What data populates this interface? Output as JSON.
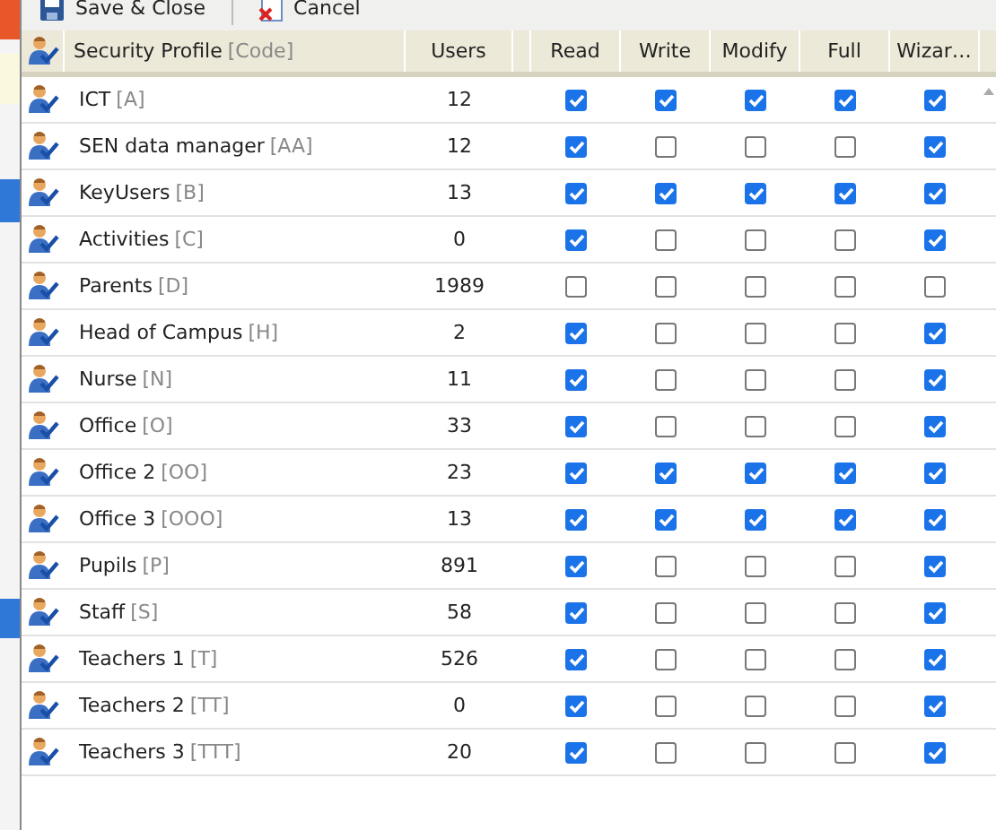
{
  "toolbar": {
    "buttons": [
      {
        "label": "Save & Close",
        "kind": "save"
      },
      {
        "label": "Cancel",
        "kind": "cancel"
      }
    ]
  },
  "table": {
    "columns": [
      {
        "label": "Security Profile",
        "code": "[Code]",
        "kind": "profile"
      },
      {
        "label": "Users",
        "kind": "count"
      },
      {
        "label": "Read",
        "kind": "check"
      },
      {
        "label": "Write",
        "kind": "check"
      },
      {
        "label": "Modify",
        "kind": "check"
      },
      {
        "label": "Full",
        "kind": "check"
      },
      {
        "label": "Wizar…",
        "kind": "check"
      }
    ],
    "rows": [
      {
        "name": "ICT",
        "code": "[A]",
        "users": "12",
        "read": true,
        "write": true,
        "modify": true,
        "full": true,
        "wizard": true
      },
      {
        "name": "SEN data manager",
        "code": "[AA]",
        "users": "12",
        "read": true,
        "write": false,
        "modify": false,
        "full": false,
        "wizard": true
      },
      {
        "name": "KeyUsers",
        "code": "[B]",
        "users": "13",
        "read": true,
        "write": true,
        "modify": true,
        "full": true,
        "wizard": true
      },
      {
        "name": "Activities",
        "code": "[C]",
        "users": "0",
        "read": true,
        "write": false,
        "modify": false,
        "full": false,
        "wizard": true
      },
      {
        "name": "Parents",
        "code": "[D]",
        "users": "1989",
        "read": false,
        "write": false,
        "modify": false,
        "full": false,
        "wizard": false
      },
      {
        "name": "Head of Campus",
        "code": "[H]",
        "users": "2",
        "read": true,
        "write": false,
        "modify": false,
        "full": false,
        "wizard": true
      },
      {
        "name": "Nurse",
        "code": "[N]",
        "users": "11",
        "read": true,
        "write": false,
        "modify": false,
        "full": false,
        "wizard": true
      },
      {
        "name": "Office",
        "code": "[O]",
        "users": "33",
        "read": true,
        "write": false,
        "modify": false,
        "full": false,
        "wizard": true
      },
      {
        "name": "Office 2",
        "code": "[OO]",
        "users": "23",
        "read": true,
        "write": true,
        "modify": true,
        "full": true,
        "wizard": true
      },
      {
        "name": "Office 3",
        "code": "[OOO]",
        "users": "13",
        "read": true,
        "write": true,
        "modify": true,
        "full": true,
        "wizard": true
      },
      {
        "name": "Pupils",
        "code": "[P]",
        "users": "891",
        "read": true,
        "write": false,
        "modify": false,
        "full": false,
        "wizard": true
      },
      {
        "name": "Staff",
        "code": "[S]",
        "users": "58",
        "read": true,
        "write": false,
        "modify": false,
        "full": false,
        "wizard": true
      },
      {
        "name": "Teachers 1",
        "code": "[T]",
        "users": "526",
        "read": true,
        "write": false,
        "modify": false,
        "full": false,
        "wizard": true
      },
      {
        "name": "Teachers 2",
        "code": "[TT]",
        "users": "0",
        "read": true,
        "write": false,
        "modify": false,
        "full": false,
        "wizard": true
      },
      {
        "name": "Teachers 3",
        "code": "[TTT]",
        "users": "20",
        "read": true,
        "write": false,
        "modify": false,
        "full": false,
        "wizard": true
      }
    ]
  }
}
